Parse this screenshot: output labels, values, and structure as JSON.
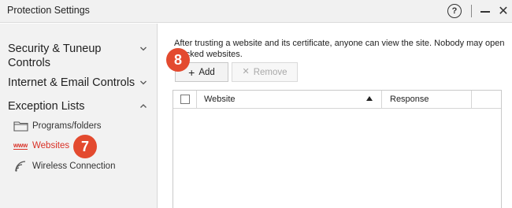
{
  "window": {
    "title": "Protection Settings",
    "help_icon": "question-circle-icon",
    "help_glyph": "?",
    "minimize_icon": "minimize-icon",
    "close_icon": "close-icon",
    "close_glyph": "✕"
  },
  "sidebar": {
    "sections": [
      {
        "label": "Security & Tuneup Controls",
        "expanded": false
      },
      {
        "label": "Internet & Email Controls",
        "expanded": false
      },
      {
        "label": "Exception Lists",
        "expanded": true
      }
    ],
    "sub_items": [
      {
        "label": "Programs/folders",
        "icon": "folder-icon",
        "active": false
      },
      {
        "label": "Websites",
        "icon": "www-icon",
        "icon_text": "www",
        "active": true
      },
      {
        "label": "Wireless Connection",
        "icon": "wifi-icon",
        "active": false
      }
    ]
  },
  "badges": {
    "websites": "7",
    "add": "8"
  },
  "main": {
    "description": "After trusting a website and its certificate, anyone can view the site. Nobody may open blocked websites.",
    "add_button": {
      "glyph": "+",
      "label": "Add"
    },
    "remove_button": {
      "glyph": "✕",
      "label": "Remove"
    },
    "table": {
      "columns": [
        "Website",
        "Response"
      ],
      "rows": []
    }
  },
  "colors": {
    "accent": "#d93025",
    "badge": "#e34a2f"
  }
}
